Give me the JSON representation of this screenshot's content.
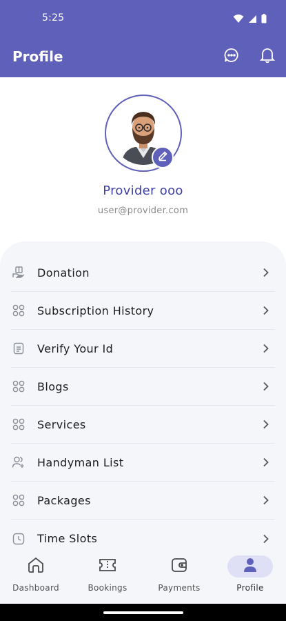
{
  "status_bar": {
    "time": "5:25"
  },
  "app_bar": {
    "title": "Profile"
  },
  "profile": {
    "name": "Provider ooo",
    "email": "user@provider.com"
  },
  "menu": {
    "items": [
      {
        "label": "Donation",
        "icon": "donation-icon"
      },
      {
        "label": "Subscription History",
        "icon": "grid-icon"
      },
      {
        "label": "Verify Your Id",
        "icon": "id-document-icon"
      },
      {
        "label": "Blogs",
        "icon": "grid-icon"
      },
      {
        "label": "Services",
        "icon": "grid-icon"
      },
      {
        "label": "Handyman List",
        "icon": "users-icon"
      },
      {
        "label": "Packages",
        "icon": "grid-icon"
      },
      {
        "label": "Time Slots",
        "icon": "clock-icon"
      }
    ]
  },
  "bottom_nav": {
    "items": [
      {
        "label": "Dashboard",
        "icon": "home-icon",
        "active": false
      },
      {
        "label": "Bookings",
        "icon": "ticket-icon",
        "active": false
      },
      {
        "label": "Payments",
        "icon": "wallet-icon",
        "active": false
      },
      {
        "label": "Profile",
        "icon": "person-icon",
        "active": true
      }
    ]
  },
  "colors": {
    "primary": "#5f60b9",
    "name_text": "#3f40a0",
    "panel_bg": "#f5f6fa",
    "active_pill": "#dfe0f5"
  }
}
